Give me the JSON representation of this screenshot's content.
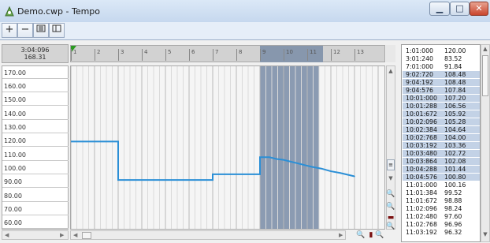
{
  "window": {
    "title": "Demo.cwp - Tempo",
    "minimize_icon": "minimize-icon",
    "maximize_icon": "maximize-icon",
    "close_icon": "close-icon"
  },
  "toolbar": {
    "add_label": "+",
    "remove_label": "−",
    "list_icon": "list-icon",
    "view_icon": "view-icon"
  },
  "position": {
    "time": "3:04:096",
    "tempo": "168.31"
  },
  "ruler": {
    "marks": [
      "1",
      "2",
      "3",
      "4",
      "5",
      "6",
      "7",
      "8",
      "9",
      "10",
      "11",
      "12",
      "13"
    ]
  },
  "chart_data": {
    "type": "line",
    "x_unit": "measure",
    "ylim": [
      55,
      175
    ],
    "ticks": [
      "170.00",
      "160.00",
      "150.00",
      "140.00",
      "130.00",
      "120.00",
      "110.00",
      "100.00",
      "90.00",
      "80.00",
      "70.00",
      "60.00"
    ],
    "selection": {
      "start": 9,
      "end": 11.5
    },
    "points": [
      {
        "x": 1,
        "y": 120.0
      },
      {
        "x": 3,
        "y": 120.0
      },
      {
        "x": 3,
        "y": 91.84
      },
      {
        "x": 7,
        "y": 91.84
      },
      {
        "x": 7,
        "y": 96.0
      },
      {
        "x": 9.0,
        "y": 96.0
      },
      {
        "x": 9.0,
        "y": 108.48
      },
      {
        "x": 9.4,
        "y": 108.48
      },
      {
        "x": 9.7,
        "y": 107.2
      },
      {
        "x": 10.0,
        "y": 106.56
      },
      {
        "x": 10.3,
        "y": 105.28
      },
      {
        "x": 10.6,
        "y": 104.0
      },
      {
        "x": 10.9,
        "y": 102.72
      },
      {
        "x": 11.2,
        "y": 101.44
      },
      {
        "x": 11.6,
        "y": 100.16
      },
      {
        "x": 12.0,
        "y": 98.24
      },
      {
        "x": 12.4,
        "y": 96.96
      },
      {
        "x": 13.0,
        "y": 94.5
      }
    ],
    "line_color": "#2b8fd6"
  },
  "tempo_list": [
    {
      "pos": "1:01:000",
      "val": "120.00",
      "selected": false
    },
    {
      "pos": "3:01:240",
      "val": "83.52",
      "selected": false
    },
    {
      "pos": "7:01:000",
      "val": "91.84",
      "selected": false
    },
    {
      "pos": "9:02:720",
      "val": "108.48",
      "selected": true
    },
    {
      "pos": "9:04:192",
      "val": "108.48",
      "selected": true
    },
    {
      "pos": "9:04:576",
      "val": "107.84",
      "selected": true
    },
    {
      "pos": "10:01:000",
      "val": "107.20",
      "selected": true
    },
    {
      "pos": "10:01:288",
      "val": "106.56",
      "selected": true
    },
    {
      "pos": "10:01:672",
      "val": "105.92",
      "selected": true
    },
    {
      "pos": "10:02:096",
      "val": "105.28",
      "selected": true
    },
    {
      "pos": "10:02:384",
      "val": "104.64",
      "selected": true
    },
    {
      "pos": "10:02:768",
      "val": "104.00",
      "selected": true
    },
    {
      "pos": "10:03:192",
      "val": "103.36",
      "selected": true
    },
    {
      "pos": "10:03:480",
      "val": "102.72",
      "selected": true
    },
    {
      "pos": "10:03:864",
      "val": "102.08",
      "selected": true
    },
    {
      "pos": "10:04:288",
      "val": "101.44",
      "selected": true
    },
    {
      "pos": "10:04:576",
      "val": "100.80",
      "selected": true
    },
    {
      "pos": "11:01:000",
      "val": "100.16",
      "selected": false
    },
    {
      "pos": "11:01:384",
      "val": "99.52",
      "selected": false
    },
    {
      "pos": "11:01:672",
      "val": "98.88",
      "selected": false
    },
    {
      "pos": "11:02:096",
      "val": "98.24",
      "selected": false
    },
    {
      "pos": "11:02:480",
      "val": "97.60",
      "selected": false
    },
    {
      "pos": "11:02:768",
      "val": "96.96",
      "selected": false
    },
    {
      "pos": "11:03:192",
      "val": "96.32",
      "selected": false
    }
  ],
  "icons": {
    "zoom_in": "zoom-in-icon",
    "zoom_out": "zoom-out-icon",
    "fit": "zoom-fit-icon"
  }
}
